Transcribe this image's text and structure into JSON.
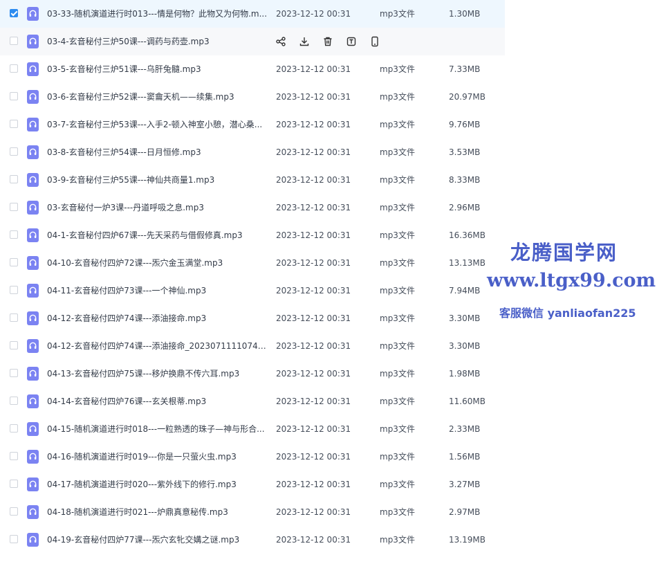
{
  "files": [
    {
      "name": "03-33-随机演道进行时013---情是何物？此物又为何物.m...",
      "date": "2023-12-12 00:31",
      "type": "mp3文件",
      "size": "1.30MB",
      "checked": true
    },
    {
      "name": "03-4-玄音秘付三炉50课---调药与药壶.mp3",
      "date": "",
      "type": "",
      "size": "",
      "checked": false,
      "hover": true
    },
    {
      "name": "03-5-玄音秘付三炉51课---乌肝兔髓.mp3",
      "date": "2023-12-12 00:31",
      "type": "mp3文件",
      "size": "7.33MB",
      "checked": false
    },
    {
      "name": "03-6-玄音秘付三炉52课---窦龠天机——续集.mp3",
      "date": "2023-12-12 00:31",
      "type": "mp3文件",
      "size": "20.97MB",
      "checked": false
    },
    {
      "name": "03-7-玄音秘付三炉53课---入手2-顿入神室小憩，潜心桑...",
      "date": "2023-12-12 00:31",
      "type": "mp3文件",
      "size": "9.76MB",
      "checked": false
    },
    {
      "name": "03-8-玄音秘付三炉54课---日月恒修.mp3",
      "date": "2023-12-12 00:31",
      "type": "mp3文件",
      "size": "3.53MB",
      "checked": false
    },
    {
      "name": "03-9-玄音秘付三炉55课---神仙共商量1.mp3",
      "date": "2023-12-12 00:31",
      "type": "mp3文件",
      "size": "8.33MB",
      "checked": false
    },
    {
      "name": "03-玄音秘付一炉3课---丹道呼吸之息.mp3",
      "date": "2023-12-12 00:31",
      "type": "mp3文件",
      "size": "2.96MB",
      "checked": false
    },
    {
      "name": "04-1-玄音秘付四炉67课---先天采药与借假修真.mp3",
      "date": "2023-12-12 00:31",
      "type": "mp3文件",
      "size": "16.36MB",
      "checked": false
    },
    {
      "name": "04-10-玄音秘付四炉72课---炁穴金玉满堂.mp3",
      "date": "2023-12-12 00:31",
      "type": "mp3文件",
      "size": "13.13MB",
      "checked": false
    },
    {
      "name": "04-11-玄音秘付四炉73课---一个神仙.mp3",
      "date": "2023-12-12 00:31",
      "type": "mp3文件",
      "size": "7.94MB",
      "checked": false
    },
    {
      "name": "04-12-玄音秘付四炉74课---添油接命.mp3",
      "date": "2023-12-12 00:31",
      "type": "mp3文件",
      "size": "3.30MB",
      "checked": false
    },
    {
      "name": "04-12-玄音秘付四炉74课---添油接命_20230711110741...",
      "date": "2023-12-12 00:31",
      "type": "mp3文件",
      "size": "3.30MB",
      "checked": false
    },
    {
      "name": "04-13-玄音秘付四炉75课---移炉换鼎不传六耳.mp3",
      "date": "2023-12-12 00:31",
      "type": "mp3文件",
      "size": "1.98MB",
      "checked": false
    },
    {
      "name": "04-14-玄音秘付四炉76课---玄关根蒂.mp3",
      "date": "2023-12-12 00:31",
      "type": "mp3文件",
      "size": "11.60MB",
      "checked": false
    },
    {
      "name": "04-15-随机演道进行时018---一粒熟透的珠子—神与形合...",
      "date": "2023-12-12 00:31",
      "type": "mp3文件",
      "size": "2.33MB",
      "checked": false
    },
    {
      "name": "04-16-随机演道进行时019---你是一只萤火虫.mp3",
      "date": "2023-12-12 00:31",
      "type": "mp3文件",
      "size": "1.56MB",
      "checked": false
    },
    {
      "name": "04-17-随机演道进行时020---紫外线下的修行.mp3",
      "date": "2023-12-12 00:31",
      "type": "mp3文件",
      "size": "3.27MB",
      "checked": false
    },
    {
      "name": "04-18-随机演道进行时021---炉鼎真意秘传.mp3",
      "date": "2023-12-12 00:31",
      "type": "mp3文件",
      "size": "2.97MB",
      "checked": false
    },
    {
      "name": "04-19-玄音秘付四炉77课---炁穴玄牝交媾之谜.mp3",
      "date": "2023-12-12 00:31",
      "type": "mp3文件",
      "size": "13.19MB",
      "checked": false
    }
  ],
  "hover_actions": [
    "share-icon",
    "download-icon",
    "delete-icon",
    "rename-icon",
    "mobile-icon"
  ],
  "colors": {
    "accent": "#2d8cf0",
    "file_icon": "#7b83f2",
    "watermark": "#4a5fc8"
  },
  "watermark": {
    "line1": "龙腾国学网",
    "line2": "www.ltgx99.com",
    "line3": "客服微信 yanliaofan225"
  }
}
